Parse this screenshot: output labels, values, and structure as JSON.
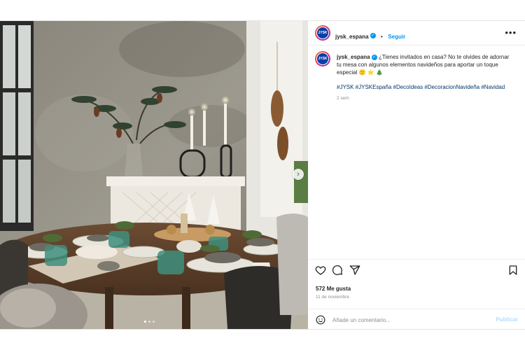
{
  "post": {
    "username": "jysk_espana",
    "avatar_text": "JYSK",
    "follow_label": "Seguir",
    "more_label": "•••",
    "caption": "¿Tienes invitados en casa? No te olvides de adornar tu mesa con algunos elementos navideños para aportar un toque especial 🙂 ⭐ 🎄",
    "hashtags": "#JYSK #JYSKEspaña #DecoIdeas #DecoracionNavideña #Navidad",
    "time_ago": "2 sem",
    "likes": "572 Me gusta",
    "date": "11 de noviembre"
  },
  "comment": {
    "placeholder": "Añade un comentario...",
    "publish_label": "Publicar"
  },
  "carousel": {
    "slides": 3,
    "active_slide": 1,
    "next_arrow": "›"
  },
  "icons": {
    "like": "heart-icon",
    "comment": "comment-icon",
    "share": "paper-plane-icon",
    "save": "bookmark-icon",
    "emoji": "emoji-icon",
    "verified": "verified-badge-icon"
  },
  "colors": {
    "accent": "#0095f6",
    "hashtag": "#00376b",
    "muted": "#8e8e8e",
    "brand": "#0b3ea8"
  }
}
